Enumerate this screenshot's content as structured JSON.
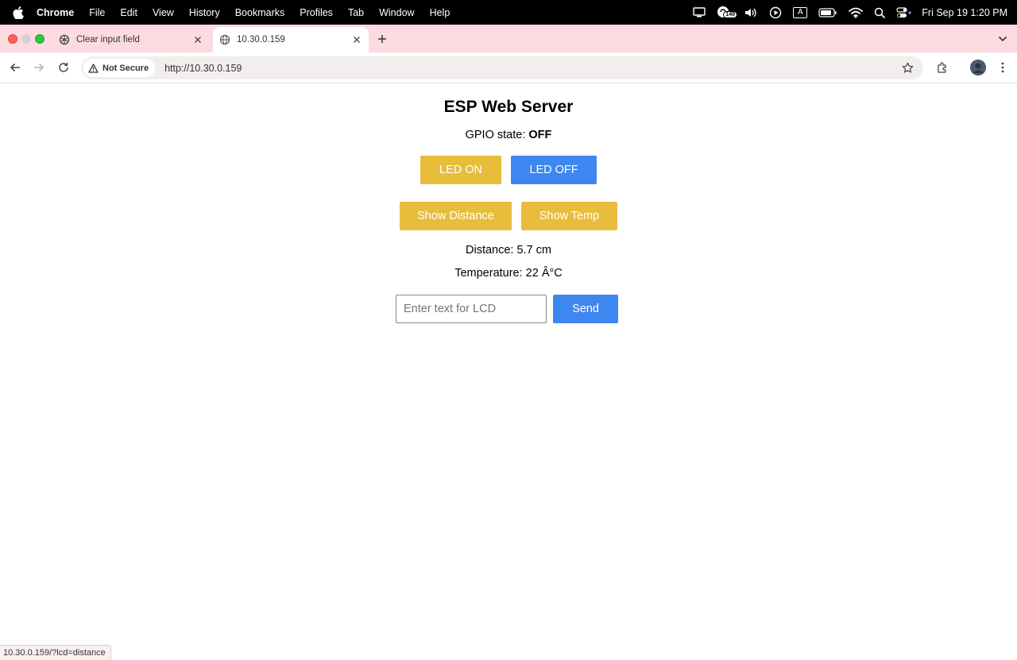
{
  "menubar": {
    "app_name": "Chrome",
    "items": [
      "File",
      "Edit",
      "View",
      "History",
      "Bookmarks",
      "Profiles",
      "Tab",
      "Window",
      "Help"
    ],
    "notification_count": "149",
    "input_source": "A",
    "clock": "Fri Sep 19  1:20 PM"
  },
  "tabs": [
    {
      "title": "Clear input field",
      "active": false,
      "icon": "openai-icon"
    },
    {
      "title": "10.30.0.159",
      "active": true,
      "icon": "globe-icon"
    }
  ],
  "toolbar": {
    "security_label": "Not Secure",
    "url": "http://10.30.0.159"
  },
  "page": {
    "title": "ESP Web Server",
    "gpio_label": "GPIO state: ",
    "gpio_value": "OFF",
    "led_on_label": "LED ON",
    "led_off_label": "LED OFF",
    "show_distance_label": "Show Distance",
    "show_temp_label": "Show Temp",
    "distance_text": "Distance: 5.7 cm",
    "temperature_text": "Temperature: 22 Â°C",
    "lcd_placeholder": "Enter text for LCD",
    "lcd_value": "",
    "send_label": "Send"
  },
  "status_bar": {
    "link_url": "10.30.0.159/?lcd=distance"
  },
  "colors": {
    "tabstrip_bg": "#fcdbe0",
    "button_yellow": "#e8bd3c",
    "button_blue": "#3e86f0"
  }
}
